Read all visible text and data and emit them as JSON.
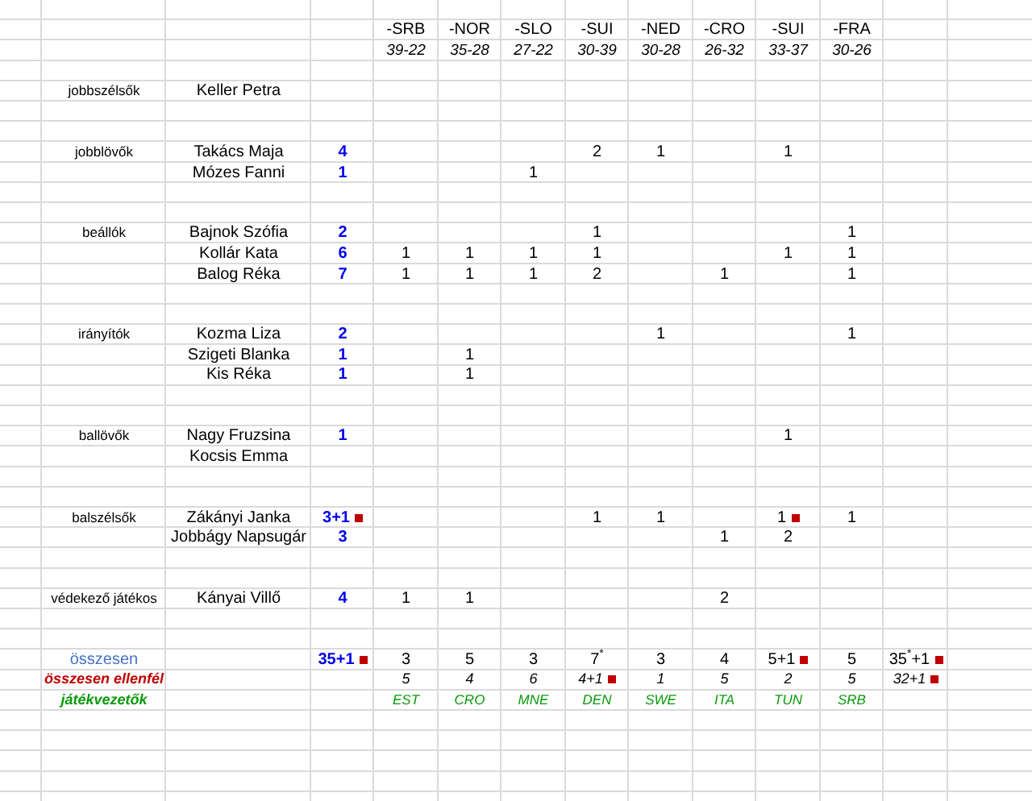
{
  "matches": [
    {
      "opponent": "-SRB",
      "score": "39-22"
    },
    {
      "opponent": "-NOR",
      "score": "35-28"
    },
    {
      "opponent": "-SLO",
      "score": "27-22"
    },
    {
      "opponent": "-SUI",
      "score": "30-39"
    },
    {
      "opponent": "-NED",
      "score": "30-28"
    },
    {
      "opponent": "-CRO",
      "score": "26-32"
    },
    {
      "opponent": "-SUI",
      "score": "33-37"
    },
    {
      "opponent": "-FRA",
      "score": "30-26"
    }
  ],
  "groups": [
    {
      "position": "jobbszélsők",
      "players": [
        {
          "name": "Keller Petra"
        }
      ]
    },
    {
      "position": "jobblövők",
      "players": [
        {
          "name": "Takács Maja",
          "total": "4",
          "goals": {
            "match_4": "2",
            "match_5": "1",
            "match_7": "1"
          }
        },
        {
          "name": "Mózes Fanni",
          "total": "1",
          "goals": {
            "match_3": "1"
          }
        }
      ]
    },
    {
      "position": "beállók",
      "players": [
        {
          "name": "Bajnok Szófia",
          "total": "2",
          "goals": {
            "match_4": "1",
            "match_8": "1"
          }
        },
        {
          "name": "Kollár Kata",
          "total": "6",
          "goals": {
            "match_1": "1",
            "match_2": "1",
            "match_3": "1",
            "match_4": "1",
            "match_7": "1",
            "match_8": "1"
          }
        },
        {
          "name": "Balog Réka",
          "total": "7",
          "goals": {
            "match_1": "1",
            "match_2": "1",
            "match_3": "1",
            "match_4": "2",
            "match_6": "1",
            "match_8": "1"
          }
        }
      ]
    },
    {
      "position": "irányítók",
      "players": [
        {
          "name": "Kozma Liza",
          "total": "2",
          "goals": {
            "match_5": "1",
            "match_8": "1"
          }
        },
        {
          "name": "Szigeti Blanka",
          "total": "1",
          "goals": {
            "match_2": "1"
          }
        },
        {
          "name": "Kis Réka",
          "total": "1",
          "goals": {
            "match_2": "1"
          }
        }
      ]
    },
    {
      "position": "ballövők",
      "players": [
        {
          "name": "Nagy Fruzsina",
          "total": "1",
          "goals": {
            "match_7": "1"
          }
        },
        {
          "name": "Kocsis Emma"
        }
      ]
    },
    {
      "position": "balszélsők",
      "players": [
        {
          "name": "Zákányi Janka",
          "total": {
            "value": "3+1",
            "flagged": true
          },
          "goals": {
            "match_4": "1",
            "match_5": "1",
            "match_7": {
              "value": "1",
              "flagged": true
            },
            "match_8": "1"
          }
        },
        {
          "name": "Jobbágy Napsugár",
          "total": "3",
          "goals": {
            "match_6": "1",
            "match_7": "2"
          }
        }
      ]
    },
    {
      "position": "védekező játékos",
      "players": [
        {
          "name": "Kányai Villő",
          "total": "4",
          "goals": {
            "match_1": "1",
            "match_2": "1",
            "match_6": "2"
          }
        }
      ]
    }
  ],
  "summary": [
    {
      "kind": "total",
      "label": "összesen",
      "total": {
        "value": "35+1",
        "flagged": true
      },
      "values": [
        "3",
        "5",
        "3",
        "7$^{*}$",
        "3",
        "4",
        {
          "value": "5+1",
          "flagged": true
        },
        "5"
      ],
      "grand": {
        "value": "35$^{*}$+1",
        "flagged": true
      }
    },
    {
      "kind": "opponent",
      "label": "összesen ellenfél",
      "values": [
        "5",
        "4",
        "6",
        {
          "value": "4+1",
          "flagged": true
        },
        "1",
        "5",
        "2",
        "5"
      ],
      "grand": {
        "value": "32+1",
        "flagged": true
      }
    },
    {
      "kind": "referee",
      "label": "játékvezetők",
      "values": [
        "EST",
        "CRO",
        "MNE",
        "DEN",
        "SWE",
        "ITA",
        "TUN",
        "SRB"
      ]
    }
  ]
}
